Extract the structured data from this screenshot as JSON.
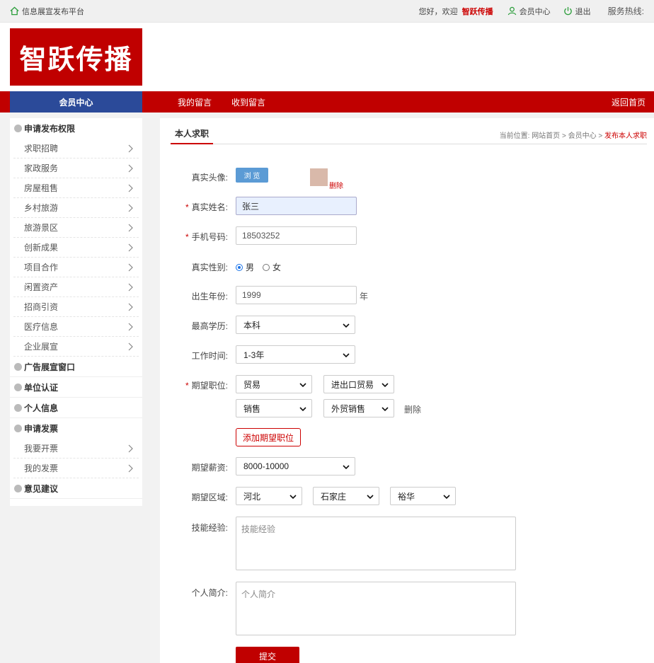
{
  "topbar": {
    "site_name": "信息展宣发布平台",
    "greeting": "您好，欢迎",
    "username": "智跃传播",
    "member_center": "会员中心",
    "logout": "退出",
    "hotline": "服务热线:"
  },
  "header": {
    "logo_text": "智跃传播"
  },
  "nav": {
    "member_center": "会员中心",
    "my_messages": "我的留言",
    "received_messages": "收到留言",
    "back_home": "返回首页"
  },
  "sidebar": {
    "sections": [
      {
        "title": "申请发布权限",
        "items": [
          "求职招聘",
          "家政服务",
          "房屋租售",
          "乡村旅游",
          "旅游景区",
          "创新成果",
          "项目合作",
          "闲置资产",
          "招商引资",
          "医疗信息",
          "企业展宣"
        ]
      },
      {
        "title": "广告展宣窗口",
        "items": []
      },
      {
        "title": "单位认证",
        "items": []
      },
      {
        "title": "个人信息",
        "items": []
      },
      {
        "title": "申请发票",
        "items": [
          "我要开票",
          "我的发票"
        ]
      },
      {
        "title": "意见建议",
        "items": []
      }
    ]
  },
  "content": {
    "tab": "本人求职",
    "breadcrumb": {
      "prefix": "当前位置:",
      "home": "网站首页",
      "member": "会员中心",
      "current": "发布本人求职",
      "sep": ">"
    },
    "form": {
      "avatar_label": "真实头像:",
      "browse": "浏 览",
      "delete_avatar": "删除",
      "name_label": "真实姓名:",
      "name_value": "张三",
      "phone_label": "手机号码:",
      "phone_value": "18503252",
      "gender_label": "真实性别:",
      "gender_male": "男",
      "gender_female": "女",
      "birth_label": "出生年份:",
      "birth_value": "1999",
      "birth_unit": "年",
      "edu_label": "最高学历:",
      "edu_value": "本科",
      "work_label": "工作时间:",
      "work_value": "1-3年",
      "job_label": "期望职位:",
      "job1_a": "贸易",
      "job1_b": "进出口贸易",
      "job2_a": "销售",
      "job2_b": "外贸销售",
      "job_delete": "删除",
      "add_job": "添加期望职位",
      "salary_label": "期望薪资:",
      "salary_value": "8000-10000",
      "region_label": "期望区域:",
      "region_province": "河北",
      "region_city": "石家庄",
      "region_district": "裕华",
      "skill_label": "技能经验:",
      "skill_placeholder": "技能经验",
      "intro_label": "个人简介:",
      "intro_placeholder": "个人简介",
      "submit": "提交"
    }
  },
  "colors": {
    "brand_red": "#c00000",
    "member_blue": "#2b4a99",
    "browse_blue": "#5b9bd5"
  }
}
